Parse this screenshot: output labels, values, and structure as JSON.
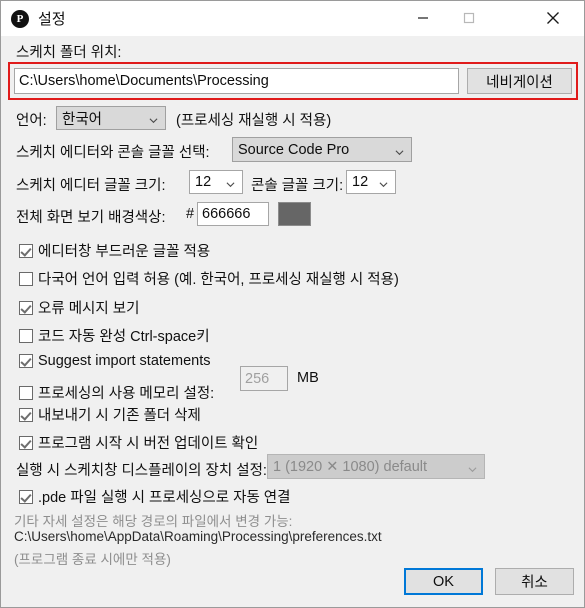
{
  "window": {
    "title": "설정",
    "app_icon": "processing-logo-icon",
    "controls": {
      "minimize": "minimize-icon",
      "maximize": "maximize-icon",
      "close": "close-icon"
    }
  },
  "sketch_folder": {
    "label": "스케치 폴더 위치:",
    "path_value": "C:\\Users\\home\\Documents\\Processing",
    "path_placeholder": "",
    "browse_button": "네비게이션",
    "highlight_color": "#e01b1b"
  },
  "language": {
    "label": "언어:",
    "value": "한국어",
    "note": "(프로세싱 재실행 시 적용)"
  },
  "editor_font": {
    "label": "스케치 에디터와 콘솔 글꼴 선택:",
    "value": "Source Code Pro"
  },
  "font_sizes": {
    "editor_label": "스케치 에디터 글꼴 크기:",
    "editor_value": "12",
    "console_label": "콘솔 글꼴 크기:",
    "console_value": "12"
  },
  "background_color": {
    "label": "전체 화면 보기 배경색상:",
    "hash": "#",
    "value": "666666",
    "swatch_hex": "#666666"
  },
  "checkboxes": [
    {
      "name": "smooth-font",
      "label": "에디터창 부드러운 글꼴 적용",
      "checked": true
    },
    {
      "name": "multilingual-input",
      "label": "다국어 언어 입력 허용 (예. 한국어, 프로세싱 재실행 시 적용)",
      "checked": false
    },
    {
      "name": "error-messages",
      "label": "오류 메시지 보기",
      "checked": true
    },
    {
      "name": "code-completion",
      "label": "코드 자동 완성 Ctrl-space키",
      "checked": false
    },
    {
      "name": "suggest-imports",
      "label": "Suggest import statements",
      "checked": true
    }
  ],
  "memory": {
    "checkbox_label": "프로세싱의 사용 메모리 설정:",
    "checked": false,
    "value": "256",
    "unit": "MB"
  },
  "checkboxes_lower": [
    {
      "name": "delete-previous-folder",
      "label": "내보내기 시 기존 폴더 삭제",
      "checked": true
    },
    {
      "name": "check-updates",
      "label": "프로그램 시작 시 버전 업데이트 확인",
      "checked": true
    }
  ],
  "display": {
    "label": "실행 시 스케치창 디스플레이의 장치 설정:",
    "value": "1 (1920 ✕ 1080) default",
    "disabled": true
  },
  "file_association": {
    "label": ".pde 파일 실행 시 프로세싱으로 자동 연결",
    "checked": true
  },
  "footer": {
    "line1": "기타 자세 설정은 해당 경로의 파일에서 변경 가능:",
    "line2": "C:\\Users\\home\\AppData\\Roaming\\Processing\\preferences.txt",
    "line3": "(프로그램 종료 시에만 적용)"
  },
  "actions": {
    "ok": "OK",
    "cancel": "취소"
  }
}
